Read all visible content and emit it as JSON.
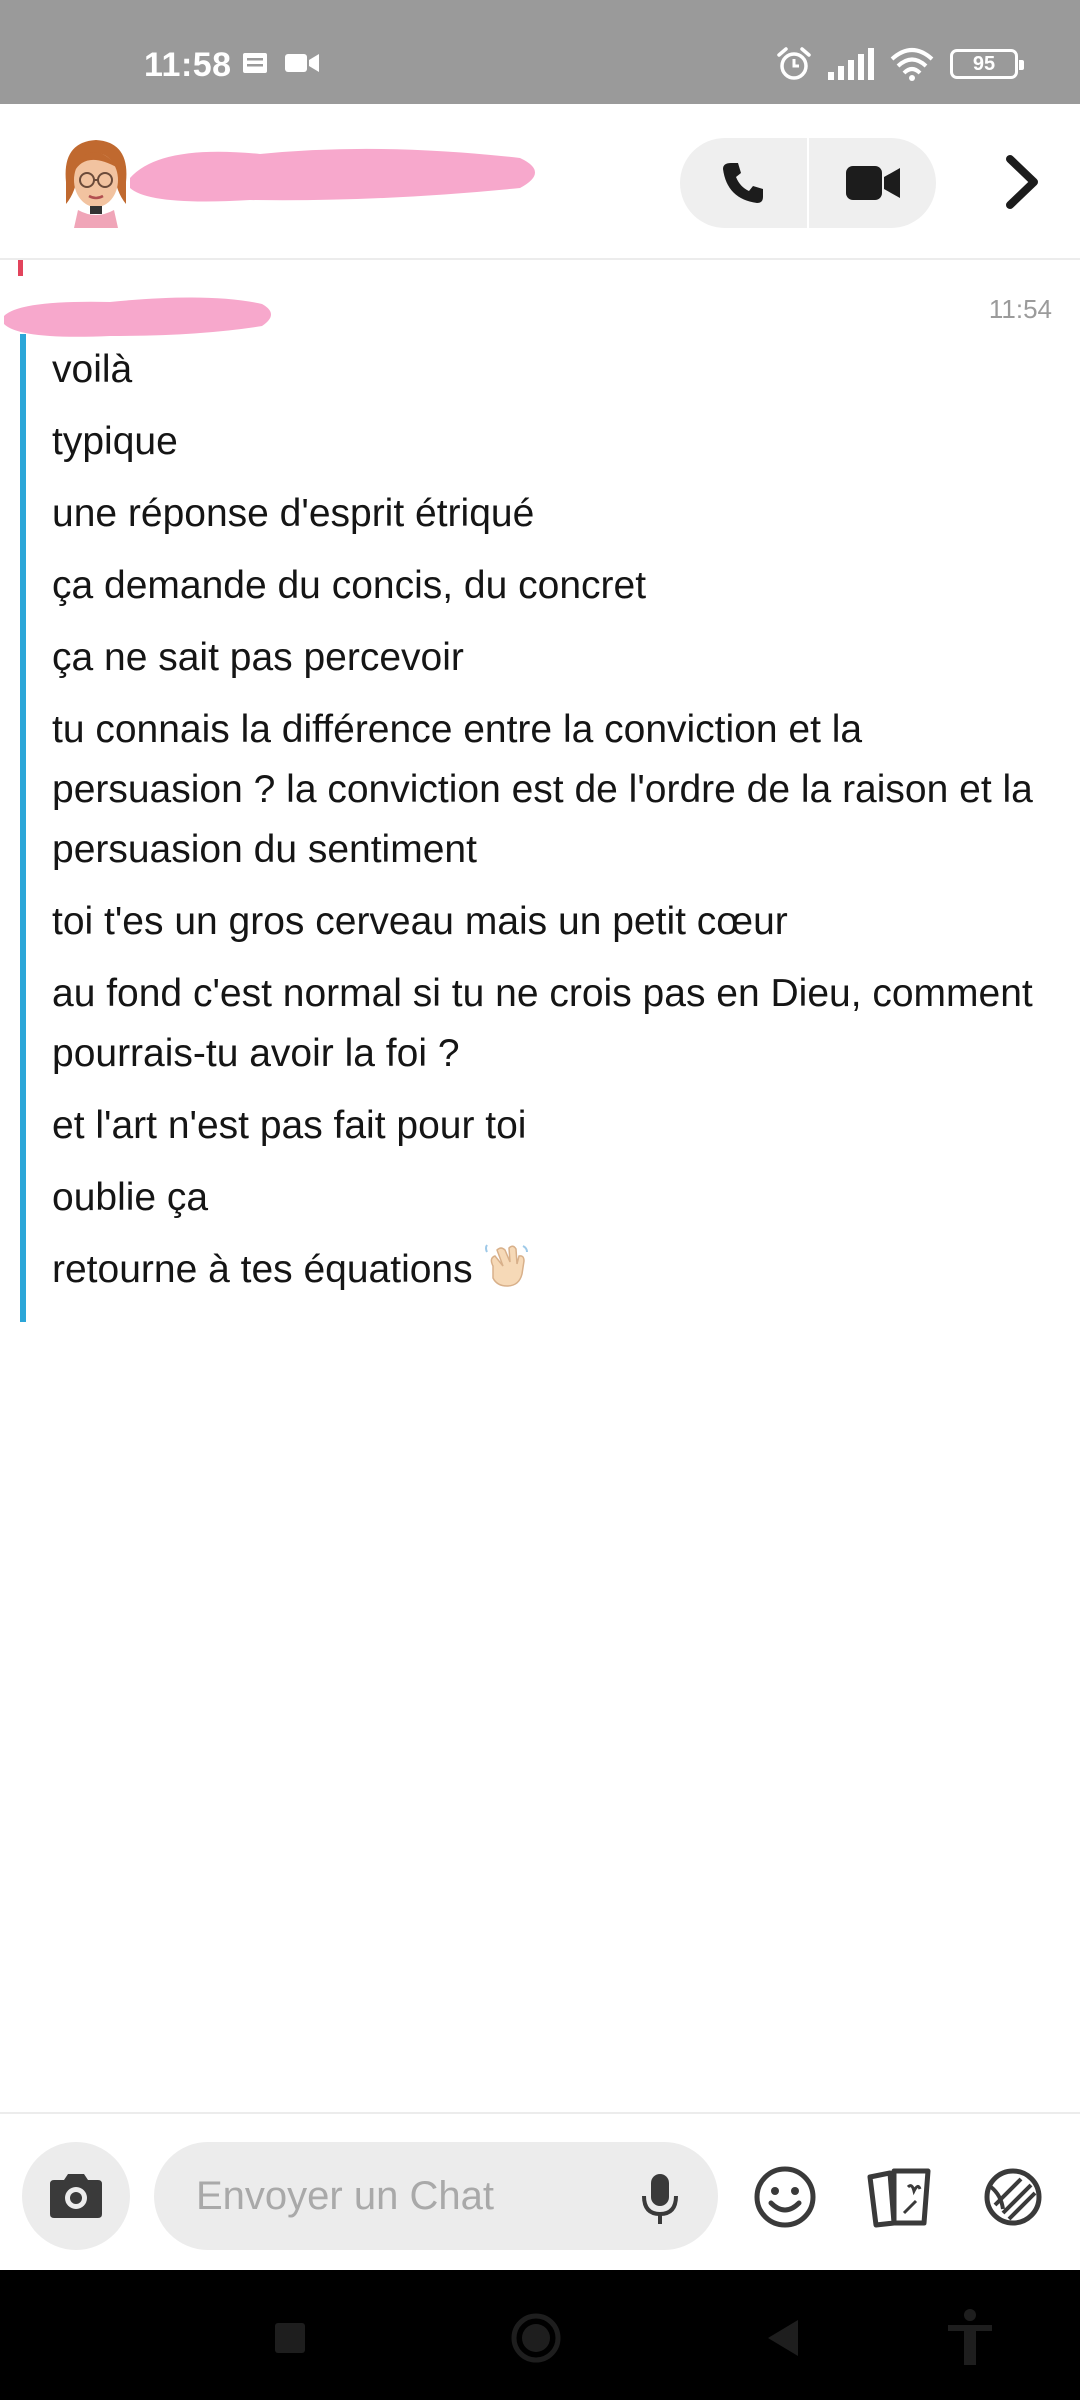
{
  "status_bar": {
    "time": "11:58",
    "battery": "95",
    "icons": [
      "message-icon",
      "video-record-icon",
      "alarm-icon",
      "signal-icon",
      "wifi-icon",
      "battery-icon"
    ]
  },
  "header": {
    "avatar": "avatar-icon",
    "contact_name": "",
    "buttons": [
      "phone-icon",
      "video-call-icon",
      "chevron-right-icon"
    ]
  },
  "conversation": {
    "timestamp": "11:54",
    "sender_color": "#2ba6d8",
    "previous_sender_color": "#e2445c",
    "messages": [
      "voilà",
      "typique",
      "une réponse d'esprit étriqué",
      "ça demande du concis, du concret",
      "ça ne sait pas percevoir",
      "tu connais la différence entre la conviction et la persuasion ? la conviction est de l'ordre de la raison et la persuasion du sentiment",
      "toi t'es un gros cerveau mais un petit cœur",
      "au fond c'est normal si tu ne crois pas en Dieu, comment pourrais-tu avoir la foi ?",
      "et l'art n'est pas fait pour toi",
      "oublie ça",
      "retourne à tes équations"
    ],
    "last_message_emoji": "waving-hand-icon"
  },
  "input_bar": {
    "placeholder": "Envoyer un Chat",
    "icons": [
      "camera-icon",
      "microphone-icon",
      "smiley-icon",
      "cards-icon",
      "rocket-icon"
    ]
  },
  "nav_bar": {
    "icons": [
      "recents-square-icon",
      "home-circle-icon",
      "back-triangle-icon",
      "accessibility-icon"
    ]
  }
}
